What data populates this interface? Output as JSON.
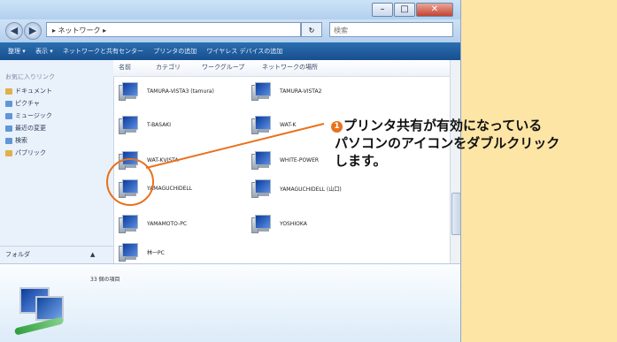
{
  "window": {
    "min_label": "–",
    "max_label": "□",
    "close_label": "✕"
  },
  "address": {
    "path": "▸ ネットワーク ▸",
    "refresh": "↻",
    "search_placeholder": "検索"
  },
  "toolbar": {
    "items": [
      "整理 ▾",
      "表示 ▾",
      "ネットワークと共有センター",
      "プリンタの追加",
      "ワイヤレス デバイスの追加"
    ]
  },
  "sidebar": {
    "header": "お気に入りリンク",
    "items": [
      {
        "label": "ドキュメント",
        "icon": "document-icon",
        "color": "#e0b04a"
      },
      {
        "label": "ピクチャ",
        "icon": "picture-icon",
        "color": "#5f96d8"
      },
      {
        "label": "ミュージック",
        "icon": "music-icon",
        "color": "#5f96d8"
      },
      {
        "label": "最近の変更",
        "icon": "recent-icon",
        "color": "#5f96d8"
      },
      {
        "label": "検索",
        "icon": "search-icon",
        "color": "#5f96d8"
      },
      {
        "label": "パブリック",
        "icon": "public-icon",
        "color": "#e0b04a"
      }
    ],
    "folders_label": "フォルダ"
  },
  "columns": [
    "名前",
    "カテゴリ",
    "ワークグループ",
    "ネットワークの場所"
  ],
  "computers": [
    "TAMURA-VISTA3 (tamura)",
    "TAMURA-VISTA2",
    "T-BASAKI",
    "WAT-K",
    "WAT-KVISTA",
    "WHITE-POWER",
    "YAMAGUCHIDELL",
    "YAMAGUCHIDELL (山口)",
    "YAMAMOTO-PC",
    "YOSHIOKA",
    "林一PC"
  ],
  "details": {
    "count": "33 個の項目"
  },
  "callout": {
    "number": "1",
    "line1": "プリンタ共有が有効になっている",
    "line2": "パソコンのアイコンをダブルクリック",
    "line3": "します。"
  },
  "colors": {
    "accent": "#e8721e",
    "background": "#fde5a6"
  }
}
